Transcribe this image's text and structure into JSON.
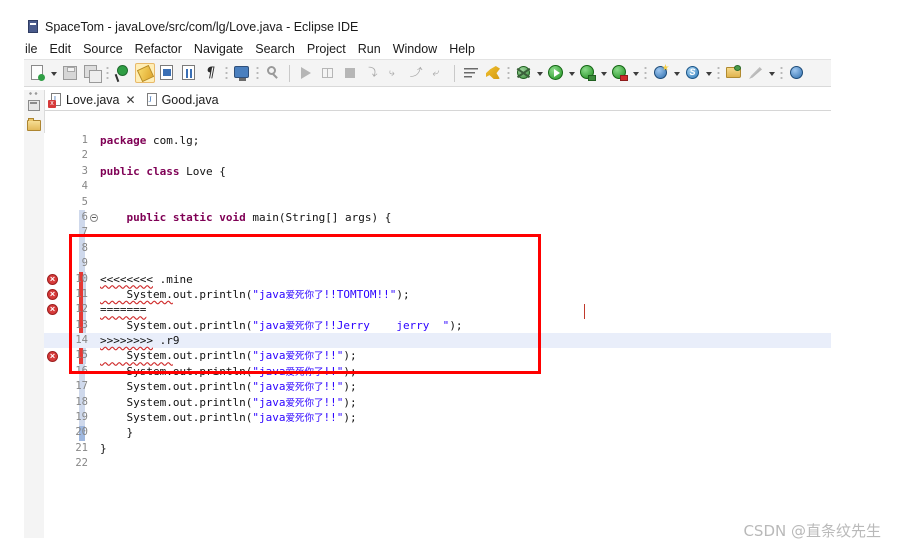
{
  "window": {
    "title": "SpaceTom - javaLove/src/com/lg/Love.java - Eclipse IDE",
    "app_icon": "eclipse-project-icon"
  },
  "menubar": {
    "items": [
      {
        "label": "ile",
        "full": "File"
      },
      {
        "label": "Edit"
      },
      {
        "label": "Source"
      },
      {
        "label": "Refactor"
      },
      {
        "label": "Navigate"
      },
      {
        "label": "Search"
      },
      {
        "label": "Project"
      },
      {
        "label": "Run"
      },
      {
        "label": "Window"
      },
      {
        "label": "Help"
      }
    ]
  },
  "toolbar": {
    "groups": [
      {
        "icons": [
          "new-wizard-icon",
          "new-dropdown-arrow"
        ]
      },
      {
        "icons": [
          "save-icon",
          "save-all-icon"
        ]
      },
      {
        "icons": [
          "skip-breakpoints-icon",
          "toggle-mark-occurrences-icon",
          "new-java-class-icon",
          "open-type-icon",
          "show-whitespace-icon"
        ]
      },
      {
        "icons": [
          "external-tools-icon"
        ]
      },
      {
        "icons": [
          "search-icon"
        ]
      },
      {
        "icons": [
          "resume-icon",
          "suspend-icon",
          "terminate-icon",
          "step-into-icon",
          "step-over-icon",
          "step-return-icon",
          "drop-to-frame-icon"
        ]
      },
      {
        "icons": [
          "next-annotation-icon",
          "previous-annotation-icon"
        ]
      },
      {
        "icons": [
          "debug-icon",
          "debug-dropdown-arrow",
          "run-icon",
          "run-dropdown-arrow"
        ]
      },
      {
        "icons": [
          "coverage-icon",
          "coverage-dropdown-arrow",
          "run-last-icon",
          "run-last-dropdown-arrow"
        ]
      },
      {
        "icons": [
          "new-java-project-icon",
          "new-project-dropdown-arrow",
          "spring-icon",
          "spring-dropdown-arrow"
        ]
      },
      {
        "icons": [
          "open-task-icon",
          "quick-access-icon",
          "task-dropdown-arrow"
        ]
      },
      {
        "icons": [
          "web-browser-icon"
        ]
      }
    ]
  },
  "editor_tabs": [
    {
      "label": "Love.java",
      "active": true,
      "has_error": true,
      "closable": true
    },
    {
      "label": "Good.java",
      "active": false,
      "has_error": false,
      "closable": false
    }
  ],
  "left_view_bar": {
    "icons": [
      "restore-view-icon",
      "package-explorer-folder-icon"
    ]
  },
  "code": {
    "language": "java",
    "lines": [
      {
        "num": "1",
        "marker": "",
        "change": "none",
        "fold": false,
        "highlight": false,
        "segments": [
          {
            "t": "package",
            "c": "kw"
          },
          {
            "t": " com.lg;",
            "c": "plain"
          }
        ]
      },
      {
        "num": "2",
        "marker": "",
        "change": "none",
        "fold": false,
        "highlight": false,
        "segments": []
      },
      {
        "num": "3",
        "marker": "",
        "change": "none",
        "fold": false,
        "highlight": false,
        "segments": [
          {
            "t": "public class",
            "c": "kw"
          },
          {
            "t": " Love {",
            "c": "plain"
          }
        ]
      },
      {
        "num": "4",
        "marker": "",
        "change": "none",
        "fold": false,
        "highlight": false,
        "segments": []
      },
      {
        "num": "5",
        "marker": "",
        "change": "none",
        "fold": false,
        "highlight": false,
        "segments": []
      },
      {
        "num": "6",
        "marker": "",
        "change": "blue",
        "fold": true,
        "highlight": false,
        "segments": [
          {
            "t": "    ",
            "c": "plain"
          },
          {
            "t": "public static void",
            "c": "kw"
          },
          {
            "t": " main(String[] args) {",
            "c": "plain"
          }
        ]
      },
      {
        "num": "7",
        "marker": "",
        "change": "blue",
        "fold": false,
        "highlight": false,
        "segments": []
      },
      {
        "num": "8",
        "marker": "",
        "change": "blue",
        "fold": false,
        "highlight": false,
        "segments": []
      },
      {
        "num": "9",
        "marker": "",
        "change": "blue",
        "fold": false,
        "highlight": false,
        "segments": []
      },
      {
        "num": "10",
        "marker": "error",
        "change": "red",
        "fold": false,
        "highlight": false,
        "segments": [
          {
            "t": "<<<<<<<<",
            "c": "conflict"
          },
          {
            "t": " .mine",
            "c": "plain"
          }
        ]
      },
      {
        "num": "11",
        "marker": "error",
        "change": "red",
        "fold": false,
        "highlight": false,
        "segments": [
          {
            "t": "    System.",
            "c": "squig"
          },
          {
            "t": "out.println(",
            "c": "plain"
          },
          {
            "t": "\"java",
            "c": "str"
          },
          {
            "t": "爱死你了",
            "c": "cjk"
          },
          {
            "t": "!!TOMTOM!!\"",
            "c": "str"
          },
          {
            "t": ");",
            "c": "plain"
          }
        ]
      },
      {
        "num": "12",
        "marker": "error",
        "change": "red",
        "fold": false,
        "highlight": false,
        "segments": [
          {
            "t": "=======",
            "c": "conflict"
          }
        ]
      },
      {
        "num": "13",
        "marker": "",
        "change": "red",
        "fold": false,
        "highlight": false,
        "segments": [
          {
            "t": "    System.out.println(",
            "c": "plain"
          },
          {
            "t": "\"java",
            "c": "str"
          },
          {
            "t": "爱死你了",
            "c": "cjk"
          },
          {
            "t": "!!Jerry    jerry  \"",
            "c": "str"
          },
          {
            "t": ");",
            "c": "plain"
          }
        ]
      },
      {
        "num": "14",
        "marker": "error",
        "change": "red",
        "fold": false,
        "highlight": true,
        "segments": [
          {
            "t": ">>>>>>>>",
            "c": "conflict"
          },
          {
            "t": " .r9",
            "c": "plain"
          }
        ]
      },
      {
        "num": "15",
        "marker": "error",
        "change": "red",
        "fold": false,
        "highlight": false,
        "segments": [
          {
            "t": "    System.",
            "c": "squig"
          },
          {
            "t": "out.println(",
            "c": "plain"
          },
          {
            "t": "\"java",
            "c": "str"
          },
          {
            "t": "爱死你了",
            "c": "cjk"
          },
          {
            "t": "!!\"",
            "c": "str"
          },
          {
            "t": ");",
            "c": "plain"
          }
        ]
      },
      {
        "num": "16",
        "marker": "",
        "change": "blue",
        "fold": false,
        "highlight": false,
        "segments": [
          {
            "t": "    System.out.println(",
            "c": "plain"
          },
          {
            "t": "\"java",
            "c": "str"
          },
          {
            "t": "爱死你了",
            "c": "cjk"
          },
          {
            "t": "!!\"",
            "c": "str"
          },
          {
            "t": ");",
            "c": "plain"
          }
        ]
      },
      {
        "num": "17",
        "marker": "",
        "change": "blue",
        "fold": false,
        "highlight": false,
        "segments": [
          {
            "t": "    System.out.println(",
            "c": "plain"
          },
          {
            "t": "\"java",
            "c": "str"
          },
          {
            "t": "爱死你了",
            "c": "cjk"
          },
          {
            "t": "!!\"",
            "c": "str"
          },
          {
            "t": ");",
            "c": "plain"
          }
        ]
      },
      {
        "num": "18",
        "marker": "",
        "change": "blue",
        "fold": false,
        "highlight": false,
        "segments": [
          {
            "t": "    System.out.println(",
            "c": "plain"
          },
          {
            "t": "\"java",
            "c": "str"
          },
          {
            "t": "爱死你了",
            "c": "cjk"
          },
          {
            "t": "!!\"",
            "c": "str"
          },
          {
            "t": ");",
            "c": "plain"
          }
        ]
      },
      {
        "num": "19",
        "marker": "",
        "change": "blue",
        "fold": false,
        "highlight": false,
        "segments": [
          {
            "t": "    System.out.println(",
            "c": "plain"
          },
          {
            "t": "\"java",
            "c": "str"
          },
          {
            "t": "爱死你了",
            "c": "cjk"
          },
          {
            "t": "!!\"",
            "c": "str"
          },
          {
            "t": ");",
            "c": "plain"
          }
        ]
      },
      {
        "num": "20",
        "marker": "",
        "change": "bluesel",
        "fold": false,
        "highlight": false,
        "segments": [
          {
            "t": "    }",
            "c": "plain"
          }
        ]
      },
      {
        "num": "21",
        "marker": "",
        "change": "none",
        "fold": false,
        "highlight": false,
        "segments": [
          {
            "t": "}",
            "c": "plain"
          }
        ]
      },
      {
        "num": "22",
        "marker": "",
        "change": "none",
        "fold": false,
        "highlight": false,
        "segments": []
      }
    ]
  },
  "annotation": {
    "type": "red-rectangle-highlight",
    "color": "#ff0000"
  },
  "watermark": {
    "text": "CSDN @直条纹先生"
  }
}
